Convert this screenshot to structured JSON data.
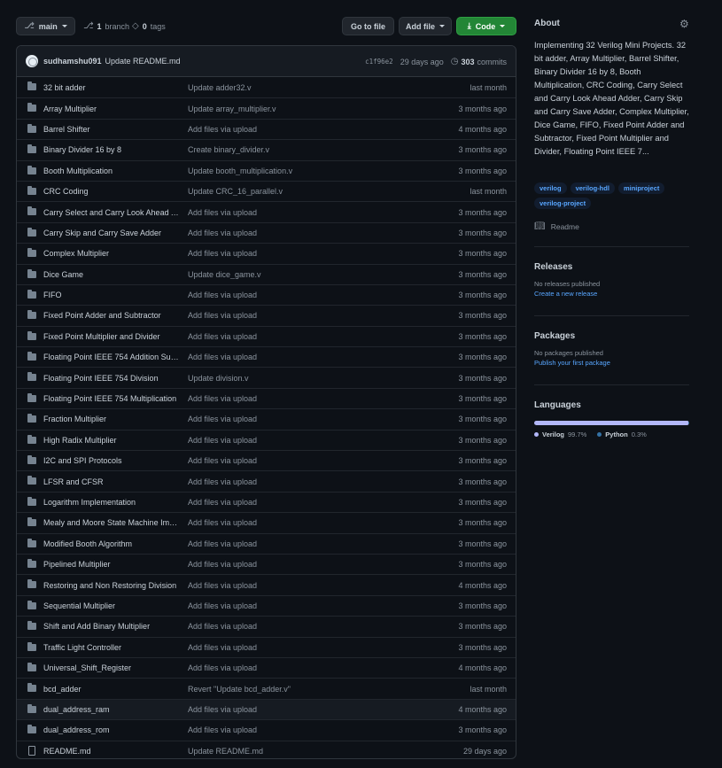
{
  "header": {
    "branch_label": "main",
    "branch_count": "1",
    "branch_word": "branch",
    "tag_count": "0",
    "tag_word": "tags",
    "go_to_file": "Go to file",
    "add_file": "Add file",
    "code": "Code"
  },
  "commit": {
    "author": "sudhamshu091",
    "message": "Update README.md",
    "sha": "c1f96e2",
    "age": "29 days ago",
    "commits_count": "303",
    "commits_word": "commits"
  },
  "files": [
    {
      "name": "32 bit adder",
      "message": "Update adder32.v",
      "age": "last month",
      "type": "dir"
    },
    {
      "name": "Array Multiplier",
      "message": "Update array_multiplier.v",
      "age": "3 months ago",
      "type": "dir"
    },
    {
      "name": "Barrel Shifter",
      "message": "Add files via upload",
      "age": "4 months ago",
      "type": "dir"
    },
    {
      "name": "Binary Divider 16 by 8",
      "message": "Create binary_divider.v",
      "age": "3 months ago",
      "type": "dir"
    },
    {
      "name": "Booth Multiplication",
      "message": "Update booth_multiplication.v",
      "age": "3 months ago",
      "type": "dir"
    },
    {
      "name": "CRC Coding",
      "message": "Update CRC_16_parallel.v",
      "age": "last month",
      "type": "dir"
    },
    {
      "name": "Carry Select and Carry Look Ahead A...",
      "message": "Add files via upload",
      "age": "3 months ago",
      "type": "dir"
    },
    {
      "name": "Carry Skip and Carry Save Adder",
      "message": "Add files via upload",
      "age": "3 months ago",
      "type": "dir"
    },
    {
      "name": "Complex Multiplier",
      "message": "Add files via upload",
      "age": "3 months ago",
      "type": "dir"
    },
    {
      "name": "Dice Game",
      "message": "Update dice_game.v",
      "age": "3 months ago",
      "type": "dir"
    },
    {
      "name": "FIFO",
      "message": "Add files via upload",
      "age": "3 months ago",
      "type": "dir"
    },
    {
      "name": "Fixed Point Adder and Subtractor",
      "message": "Add files via upload",
      "age": "3 months ago",
      "type": "dir"
    },
    {
      "name": "Fixed Point Multiplier and Divider",
      "message": "Add files via upload",
      "age": "3 months ago",
      "type": "dir"
    },
    {
      "name": "Floating Point IEEE 754 Addition Subt...",
      "message": "Add files via upload",
      "age": "3 months ago",
      "type": "dir"
    },
    {
      "name": "Floating Point IEEE 754 Division",
      "message": "Update division.v",
      "age": "3 months ago",
      "type": "dir"
    },
    {
      "name": "Floating Point IEEE 754 Multiplication",
      "message": "Add files via upload",
      "age": "3 months ago",
      "type": "dir"
    },
    {
      "name": "Fraction Multiplier",
      "message": "Add files via upload",
      "age": "3 months ago",
      "type": "dir"
    },
    {
      "name": "High Radix Multiplier",
      "message": "Add files via upload",
      "age": "3 months ago",
      "type": "dir"
    },
    {
      "name": "I2C and SPI Protocols",
      "message": "Add files via upload",
      "age": "3 months ago",
      "type": "dir"
    },
    {
      "name": "LFSR and CFSR",
      "message": "Add files via upload",
      "age": "3 months ago",
      "type": "dir"
    },
    {
      "name": "Logarithm Implementation",
      "message": "Add files via upload",
      "age": "3 months ago",
      "type": "dir"
    },
    {
      "name": "Mealy and Moore State Machine Impl...",
      "message": "Add files via upload",
      "age": "3 months ago",
      "type": "dir"
    },
    {
      "name": "Modified Booth Algorithm",
      "message": "Add files via upload",
      "age": "3 months ago",
      "type": "dir"
    },
    {
      "name": "Pipelined Multiplier",
      "message": "Add files via upload",
      "age": "3 months ago",
      "type": "dir"
    },
    {
      "name": "Restoring and Non Restoring Division",
      "message": "Add files via upload",
      "age": "4 months ago",
      "type": "dir"
    },
    {
      "name": "Sequential Multiplier",
      "message": "Add files via upload",
      "age": "3 months ago",
      "type": "dir"
    },
    {
      "name": "Shift and Add Binary Multiplier",
      "message": "Add files via upload",
      "age": "3 months ago",
      "type": "dir"
    },
    {
      "name": "Traffic Light Controller",
      "message": "Add files via upload",
      "age": "3 months ago",
      "type": "dir"
    },
    {
      "name": "Universal_Shift_Register",
      "message": "Add files via upload",
      "age": "4 months ago",
      "type": "dir"
    },
    {
      "name": "bcd_adder",
      "message": "Revert \"Update bcd_adder.v\"",
      "age": "last month",
      "type": "dir"
    },
    {
      "name": "dual_address_ram",
      "message": "Add files via upload",
      "age": "4 months ago",
      "type": "dir"
    },
    {
      "name": "dual_address_rom",
      "message": "Add files via upload",
      "age": "3 months ago",
      "type": "dir"
    },
    {
      "name": "README.md",
      "message": "Update README.md",
      "age": "29 days ago",
      "type": "file"
    }
  ],
  "about": {
    "heading": "About",
    "description": "Implementing 32 Verilog Mini Projects. 32 bit adder, Array Multiplier, Barrel Shifter, Binary Divider 16 by 8, Booth Multiplication, CRC Coding, Carry Select and Carry Look Ahead Adder, Carry Skip and Carry Save Adder, Complex Multiplier, Dice Game, FIFO, Fixed Point Adder and Subtractor, Fixed Point Multiplier and Divider, Floating Point IEEE 7...",
    "topics": [
      "verilog",
      "verilog-hdl",
      "miniproject",
      "verilog-project"
    ],
    "readme_label": "Readme"
  },
  "releases": {
    "heading": "Releases",
    "empty": "No releases published",
    "create_link": "Create a new release"
  },
  "packages": {
    "heading": "Packages",
    "empty": "No packages published",
    "publish_link": "Publish your first package"
  },
  "languages": {
    "heading": "Languages",
    "items": [
      {
        "name": "Verilog",
        "percent": "99.7%",
        "share": 99.7,
        "color": "#b2b7f8"
      },
      {
        "name": "Python",
        "percent": "0.3%",
        "share": 0.3,
        "color": "#3572A5"
      }
    ]
  },
  "colors": {
    "code_button": "#238636",
    "link": "#58a6ff",
    "background": "#0d1117"
  }
}
